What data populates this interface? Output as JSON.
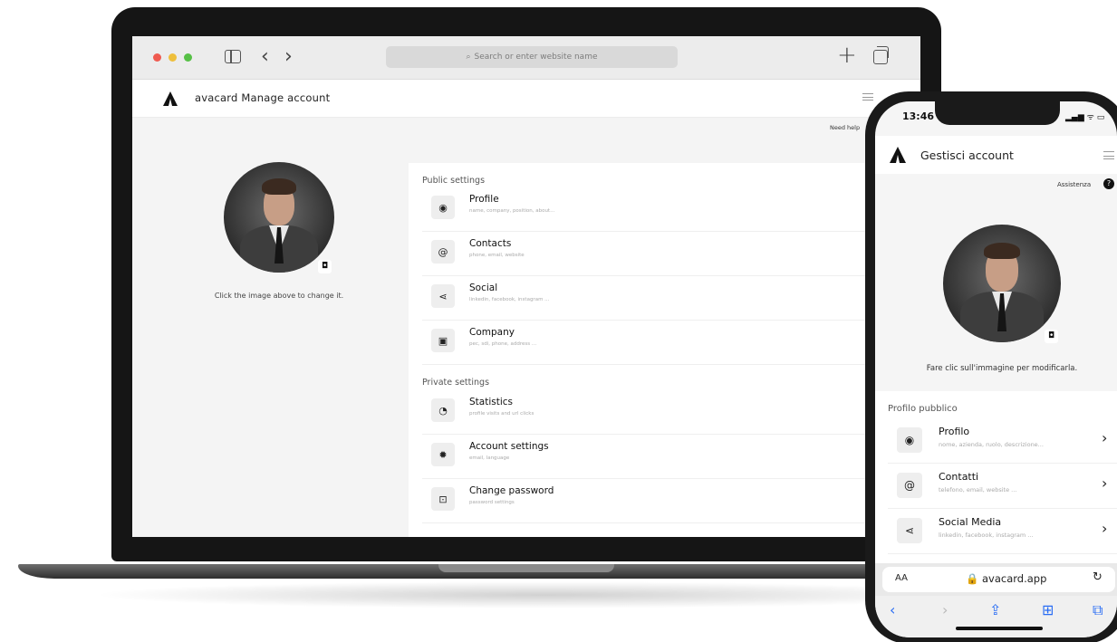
{
  "browser": {
    "url_placeholder": "Search or enter website name",
    "back_glyph": "‹",
    "forward_glyph": "›",
    "new_tab_glyph": "+"
  },
  "desktop_app": {
    "title": "avacard Manage account",
    "need_help": "Need help",
    "change_hint": "Click the image above to change it.",
    "public_section": "Public settings",
    "private_section": "Private settings",
    "public_items": [
      {
        "title": "Profile",
        "subtitle": "name, company, position, about...",
        "icon": "user-icon",
        "glyph": "◉"
      },
      {
        "title": "Contacts",
        "subtitle": "phone, email, website",
        "icon": "at-icon",
        "glyph": "@"
      },
      {
        "title": "Social",
        "subtitle": "linkedin, facebook, instagram ...",
        "icon": "share-icon",
        "glyph": "⋖"
      },
      {
        "title": "Company",
        "subtitle": "pec, sdi, phone, address ...",
        "icon": "building-icon",
        "glyph": "▣"
      }
    ],
    "private_items": [
      {
        "title": "Statistics",
        "subtitle": "profile visits and url clicks",
        "icon": "chart-icon",
        "glyph": "◔"
      },
      {
        "title": "Account settings",
        "subtitle": "email, language",
        "icon": "gear-icon",
        "glyph": "✹"
      },
      {
        "title": "Change password",
        "subtitle": "password settings",
        "icon": "lock-icon",
        "glyph": "⊡"
      }
    ],
    "chevron": "›",
    "camera_glyph": "◘"
  },
  "phone_app": {
    "time": "13:46",
    "status": "▂▄▆ ᯤ ▭",
    "title": "Gestisci account",
    "help": "Assistenza",
    "help_glyph": "?",
    "change_hint": "Fare clic sull'immagine per modificarla.",
    "public_section": "Profilo pubblico",
    "items": [
      {
        "title": "Profilo",
        "subtitle": "nome, azienda, ruolo, descrizione...",
        "icon": "user-icon",
        "glyph": "◉"
      },
      {
        "title": "Contatti",
        "subtitle": "telefono, email, website ...",
        "icon": "at-icon",
        "glyph": "@"
      },
      {
        "title": "Social Media",
        "subtitle": "linkedin, facebook, instagram ...",
        "icon": "share-icon",
        "glyph": "⋖"
      }
    ],
    "chevron": "›",
    "camera_glyph": "◘",
    "url_aa": "AA",
    "url": "🔒 avacard.app",
    "reload_glyph": "↻",
    "toolbar": {
      "back": "‹",
      "forward": "›",
      "share": "⇪",
      "bookmarks": "⊞",
      "tabs": "⧉"
    }
  },
  "colors": {
    "traffic_red": "#ef5a50",
    "traffic_yellow": "#eebf3c",
    "traffic_green": "#56c046",
    "ios_blue": "#2a6df4"
  }
}
